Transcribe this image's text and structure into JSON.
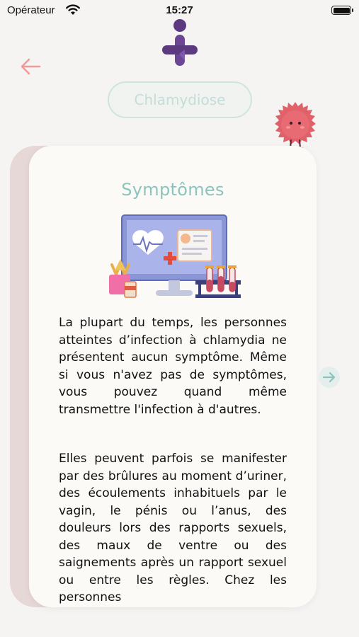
{
  "status_bar": {
    "carrier": "Opérateur",
    "time": "15:27"
  },
  "header": {
    "topic": "Chlamydiose"
  },
  "card": {
    "title": "Symptômes",
    "paragraphs": [
      "La plupart du temps, les personnes atteintes d’infection à chlamydia ne présentent aucun symptôme. Même si vous n'avez pas de symptômes, vous pouvez quand même transmettre l'infection à d'autres.",
      "Elles peuvent parfois se manifester par des brûlures au moment d’uriner, des écoulements inhabituels par le vagin, le pénis ou l’anus, des douleurs lors des rapports sexuels, des maux de ventre ou des saignements après un rapport sexuel ou entre les règles. Chez les personnes"
    ]
  },
  "colors": {
    "accent_teal": "#8bc4bd",
    "back_arrow": "#f09a9a",
    "logo_purple": "#5b3a80",
    "mascot_red": "#e0616a"
  },
  "icons": {
    "back": "arrow-left-icon",
    "next": "arrow-right-icon",
    "wifi": "wifi-icon",
    "battery": "battery-icon"
  }
}
